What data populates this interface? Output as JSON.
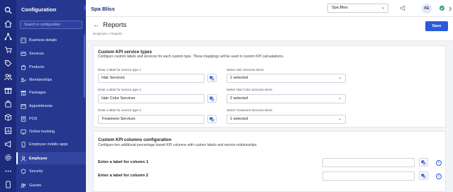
{
  "app": {
    "brand": "Spa Bliss",
    "location_selected": "Spa Bliss",
    "user_initials": "KE"
  },
  "sidebar": {
    "title": "Configuration",
    "search_placeholder": "Search in configuration",
    "items": [
      {
        "label": "Business details",
        "icon": "building-icon"
      },
      {
        "label": "Services",
        "icon": "services-icon"
      },
      {
        "label": "Products",
        "icon": "products-icon"
      },
      {
        "label": "Memberships",
        "icon": "memberships-icon"
      },
      {
        "label": "Packages",
        "icon": "packages-icon"
      },
      {
        "label": "Appointments",
        "icon": "appointments-icon"
      },
      {
        "label": "POS",
        "icon": "pos-icon"
      },
      {
        "label": "Online booking",
        "icon": "online-booking-icon"
      },
      {
        "label": "Employee mobile apps",
        "icon": "mobile-icon"
      },
      {
        "label": "Employee",
        "icon": "employee-icon",
        "active": true
      },
      {
        "label": "Security",
        "icon": "shield-icon"
      },
      {
        "label": "Guests",
        "icon": "guests-icon"
      }
    ]
  },
  "header": {
    "title": "Reports",
    "breadcrumb": "Employee  >  Reports",
    "save_label": "Save"
  },
  "kpi_types": {
    "title": "Custom KPI service types",
    "description": "Configure custom labels and services for each custom type. These mappings will be used in custom KPI calcualations.",
    "rows": [
      {
        "label_caption": "Enter a label for service type 1",
        "label_value": "Hair Services",
        "items_caption": "Select Hair Services items",
        "items_value": "1 selected"
      },
      {
        "label_caption": "Enter a label for service type 2",
        "label_value": "Hair Color Services",
        "items_caption": "Select Hair Color Services items",
        "items_value": "2 selected"
      },
      {
        "label_caption": "Enter a label for service type 3",
        "label_value": "Treatment Services",
        "items_caption": "Select Treatment Services items",
        "items_value": "1 selected"
      }
    ]
  },
  "kpi_columns": {
    "title": "Custom KPI columns configuration",
    "description": "Configure two additional percentage based KPI columns with custom labels and service relationships.",
    "col1_label": "Enter a label for column 1",
    "col2_label": "Enter a label for column 2",
    "col1_value": "",
    "col2_value": ""
  },
  "colors": {
    "rail": "#1d2b7c",
    "sidebar": "#26378f",
    "primary": "#2e59d9"
  }
}
